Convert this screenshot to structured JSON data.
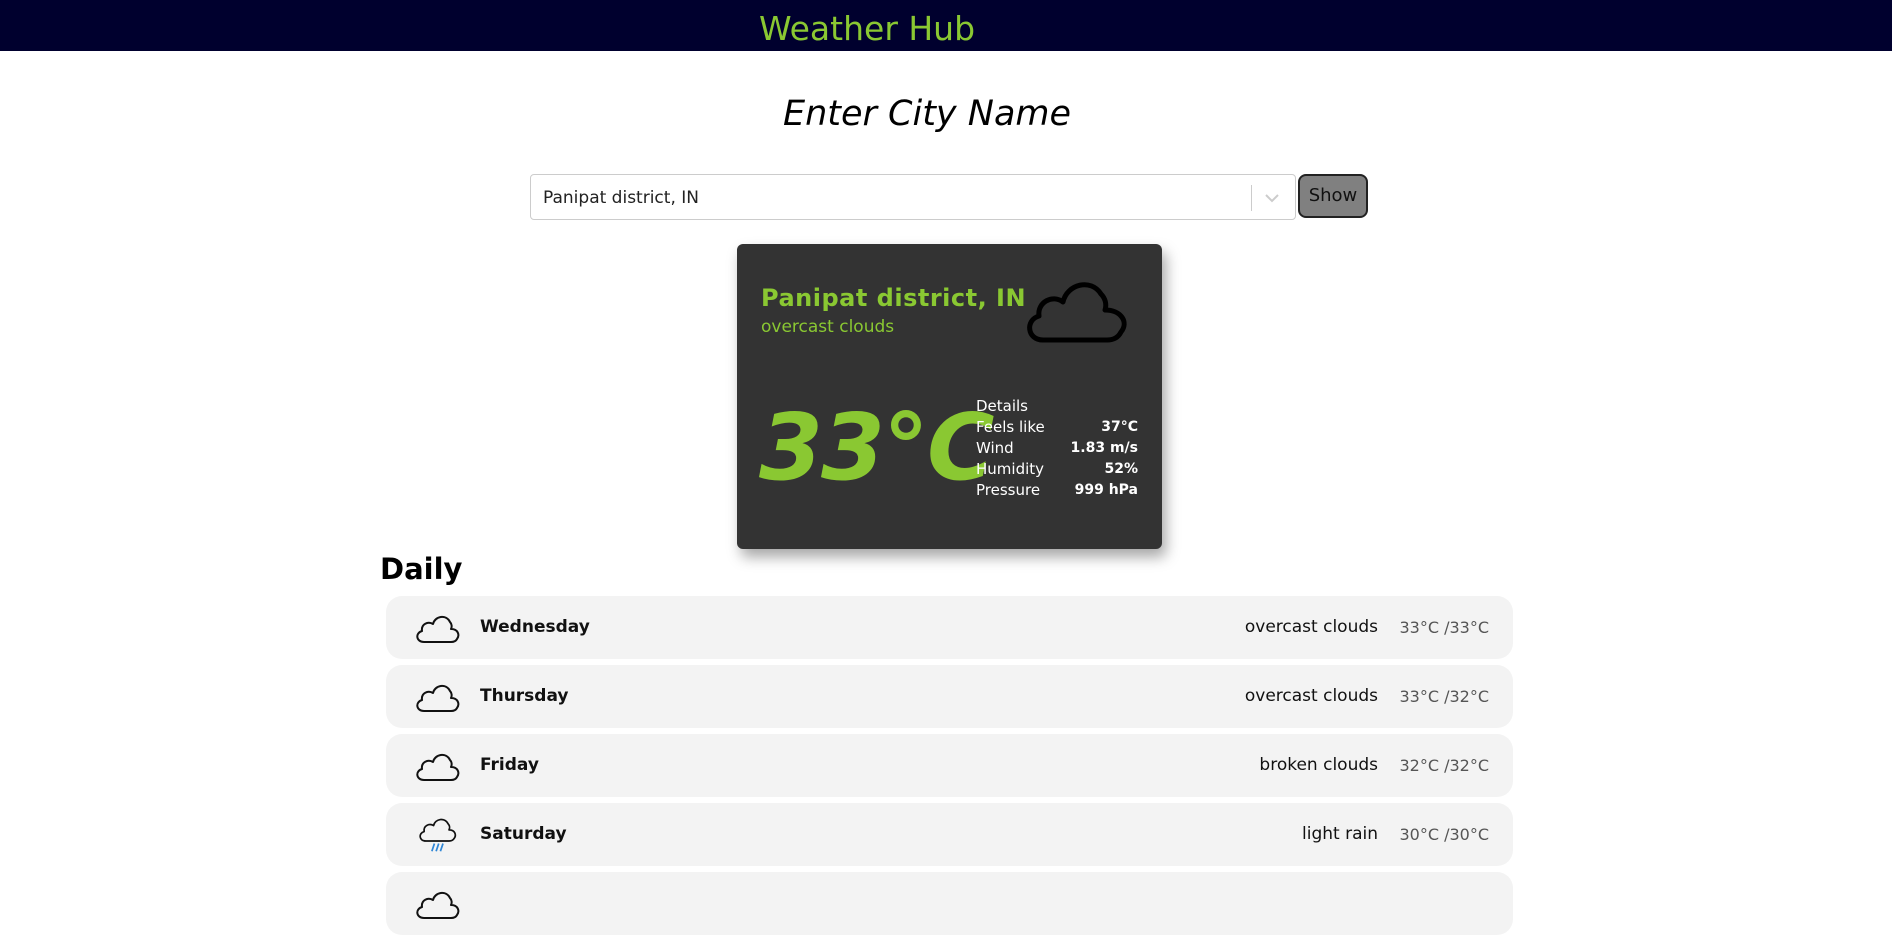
{
  "header": {
    "title": "Weather Hub"
  },
  "search": {
    "heading": "Enter City Name",
    "selected_value": "Panipat district, IN",
    "button_label": "Show"
  },
  "current": {
    "city": "Panipat district, IN",
    "description": "overcast clouds",
    "icon": "cloud-icon",
    "temperature": "33°C",
    "details_label": "Details",
    "details": [
      {
        "label": "Feels like",
        "value": "37°C"
      },
      {
        "label": "Wind",
        "value": "1.83 m/s"
      },
      {
        "label": "Humidity",
        "value": "52%"
      },
      {
        "label": "Pressure",
        "value": "999 hPa"
      }
    ]
  },
  "daily": {
    "title": "Daily",
    "items": [
      {
        "day": "Wednesday",
        "condition": "overcast clouds",
        "range": "33°C /33°C",
        "icon": "cloud-icon"
      },
      {
        "day": "Thursday",
        "condition": "overcast clouds",
        "range": "33°C /32°C",
        "icon": "cloud-icon"
      },
      {
        "day": "Friday",
        "condition": "broken clouds",
        "range": "32°C /32°C",
        "icon": "cloud-icon"
      },
      {
        "day": "Saturday",
        "condition": "light rain",
        "range": "30°C /30°C",
        "icon": "rain-cloud-icon"
      }
    ]
  },
  "colors": {
    "header_bg": "#00002e",
    "accent": "#8ac832",
    "card_bg": "#333333",
    "row_bg": "#f3f3f3",
    "rain": "#2e86d6"
  }
}
